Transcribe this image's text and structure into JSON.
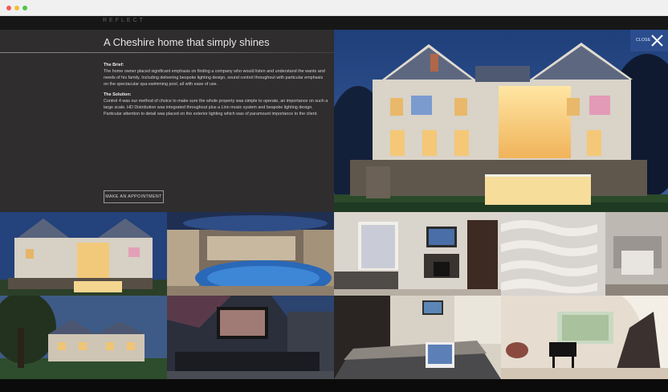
{
  "header": {
    "logo_text": "REFLECT"
  },
  "project": {
    "title": "A Cheshire home that simply shines",
    "brief_heading": "The Brief:",
    "brief_text": "The home owner placed significant emphasis on finding a company who would listen and understand the wants and needs of his family. Including delivering bespoke lighting design, sound control throughout with particular emphasis on the spectacular spa-swimming pool, all with ease of use.",
    "solution_heading": "The Solution:",
    "solution_text": "Control 4 was our method of choice to make sure the whole property was simple to operate, an importance on such a large scale. HD Distribution was integrated throughout plus a Linn music system and bespoke lighting design. Particular attention to detail was placed on the exterior lighting which was of paramount importance to the client.",
    "appointment_button": "MAKE AN APPOINTMENT"
  },
  "close": {
    "label": "CLOSE"
  },
  "gallery": [
    {
      "name": "house-exterior-dusk"
    },
    {
      "name": "indoor-swimming-pool"
    },
    {
      "name": "living-room-fireplace"
    },
    {
      "name": "sculpted-wall-hallway"
    },
    {
      "name": "house-with-trees"
    },
    {
      "name": "cinema-room"
    },
    {
      "name": "kitchen-island"
    },
    {
      "name": "staircase-piano"
    }
  ],
  "colors": {
    "accent": "#2b4d8e",
    "panel": "#2f2d2d"
  }
}
